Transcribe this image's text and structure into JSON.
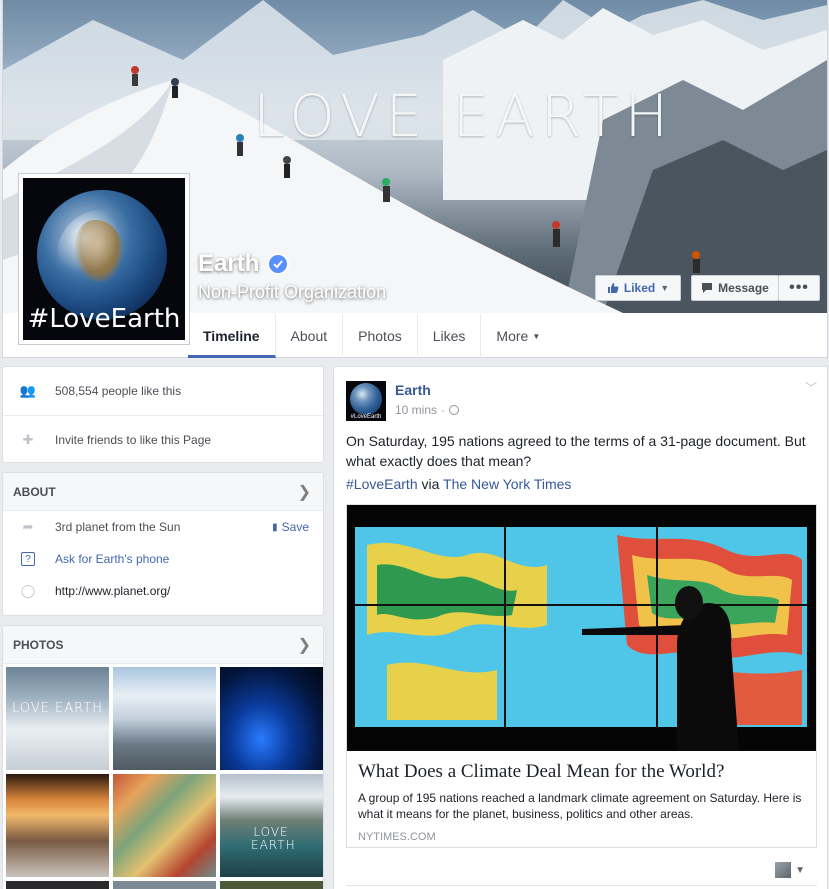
{
  "cover": {
    "title": "LOVE EARTH"
  },
  "profile": {
    "tag": "#LoveEarth"
  },
  "page": {
    "name": "Earth",
    "category": "Non-Profit Organization"
  },
  "actions": {
    "liked_label": "Liked",
    "message_label": "Message",
    "more_label": "•••"
  },
  "tabs": [
    {
      "label": "Timeline",
      "active": true
    },
    {
      "label": "About"
    },
    {
      "label": "Photos"
    },
    {
      "label": "Likes"
    },
    {
      "label": "More"
    }
  ],
  "sidebar": {
    "likes_text": "508,554 people like this",
    "invite_text": "Invite friends to like this Page",
    "about": {
      "header": "ABOUT",
      "description": "3rd planet from the Sun",
      "save_label": "Save",
      "phone_link": "Ask for Earth's phone",
      "website": "http://www.planet.org/"
    },
    "photos": {
      "header": "PHOTOS",
      "overlay_1": "LOVE EARTH",
      "overlay_6": "LOVE EARTH"
    }
  },
  "post": {
    "author": "Earth",
    "time": "10 mins",
    "text": "On Saturday, 195 nations agreed to the terms of a 31-page document. But what exactly does that mean?",
    "hashtag": "#LoveEarth",
    "via": "via",
    "source_link": "The New York Times",
    "attachment": {
      "title": "What Does a Climate Deal Mean for the World?",
      "description": "A group of 195 nations reached a landmark climate agreement on Saturday. Here is what it means for the planet, business, politics and other areas.",
      "source": "NYTIMES.COM"
    }
  },
  "colors": {
    "fb_blue": "#4267b2",
    "link_blue": "#365899",
    "page_bg": "#e9ebee"
  }
}
